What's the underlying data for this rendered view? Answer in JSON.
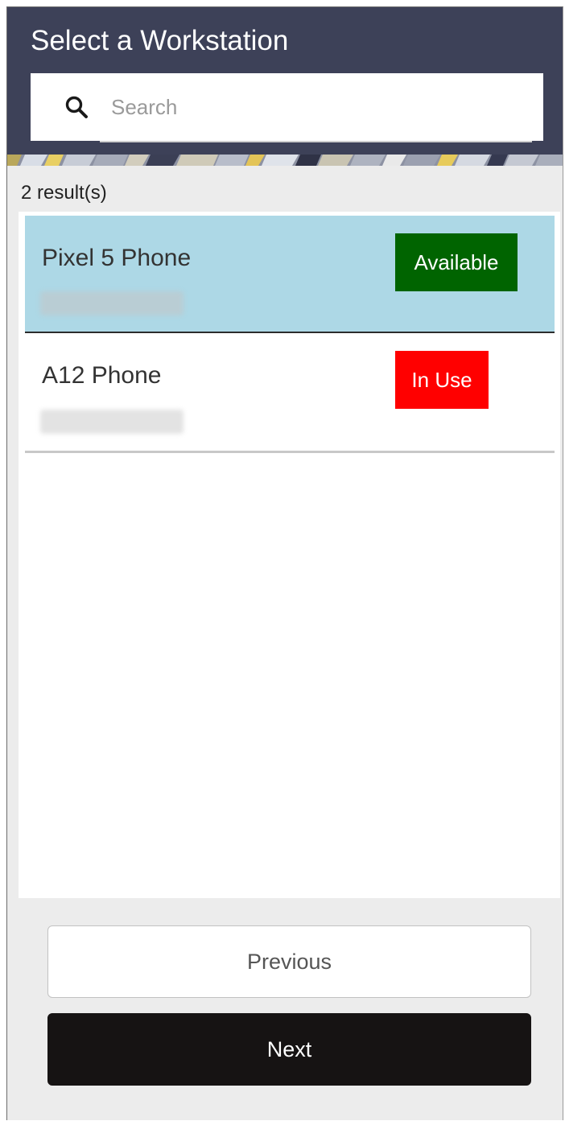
{
  "header": {
    "title": "Select a Workstation"
  },
  "search": {
    "placeholder": "Search",
    "value": "",
    "icon": "search-icon"
  },
  "results": {
    "count_label": "2 result(s)"
  },
  "workstations": [
    {
      "name": "Pixel 5 Phone",
      "status": "Available",
      "status_color": "#006400",
      "selected": true
    },
    {
      "name": "A12 Phone",
      "status": "In Use",
      "status_color": "#ff0000",
      "selected": false
    }
  ],
  "footer": {
    "previous_label": "Previous",
    "next_label": "Next"
  },
  "colors": {
    "header_bg": "#3d4158",
    "selected_row_bg": "#add8e6",
    "next_button_bg": "#161313"
  }
}
